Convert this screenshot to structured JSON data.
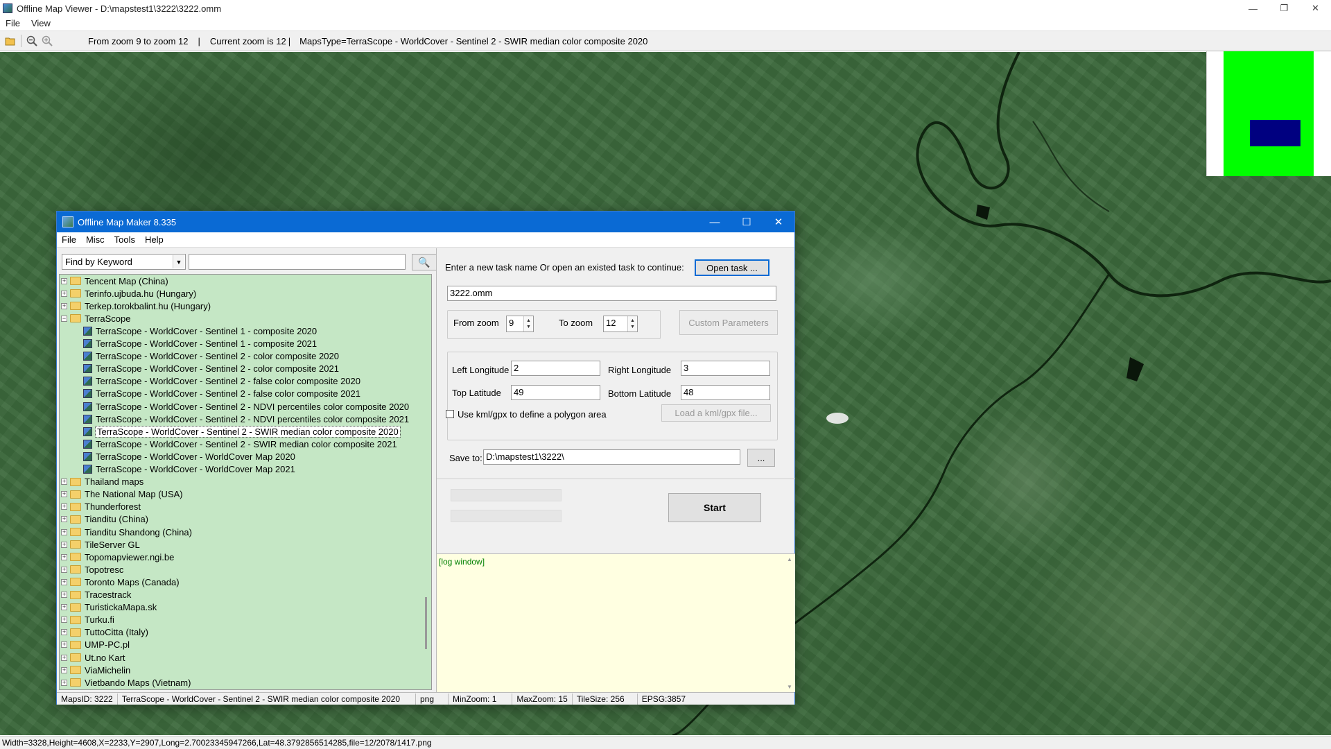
{
  "window": {
    "title": "Offline Map Viewer - D:\\mapstest1\\3222\\3222.omm",
    "minimize": "—",
    "maximize": "❐",
    "close": "✕"
  },
  "menu": [
    "File",
    "View"
  ],
  "toolbar": {
    "zoom_range": "From zoom 9 to zoom 12",
    "current_zoom": "Current zoom is 12",
    "maps_type": "MapsType=TerraScope - WorldCover - Sentinel 2 - SWIR median color composite 2020",
    "sep1": "|",
    "sep2": "|"
  },
  "statusbar": {
    "text": "Width=3328,Height=4608,X=2233,Y=2907,Long=2.70023345947266,Lat=48.3792856514285,file=12/2078/1417.png"
  },
  "minimap": {
    "bg_color": "#00ff00",
    "view_color": "#000080"
  },
  "dialog": {
    "title": "Offline Map Maker 8.335",
    "minimize": "—",
    "maximize": "☐",
    "close": "✕",
    "menu": [
      "File",
      "Misc",
      "Tools",
      "Help"
    ],
    "search": {
      "mode": "Find by Keyword",
      "keyword": "",
      "dropdown_glyph": "▼",
      "search_glyph": "🔍"
    },
    "tree": [
      {
        "label": "Tencent Map (China)",
        "type": "folder",
        "expanded": false
      },
      {
        "label": "Terinfo.ujbuda.hu (Hungary)",
        "type": "folder",
        "expanded": false
      },
      {
        "label": "Terkep.torokbalint.hu (Hungary)",
        "type": "folder",
        "expanded": false
      },
      {
        "label": "TerraScope",
        "type": "folder",
        "expanded": true
      },
      {
        "label": "TerraScope - WorldCover - Sentinel 1 - composite 2020",
        "type": "map"
      },
      {
        "label": "TerraScope - WorldCover - Sentinel 1 - composite 2021",
        "type": "map"
      },
      {
        "label": "TerraScope - WorldCover - Sentinel 2 - color composite 2020",
        "type": "map"
      },
      {
        "label": "TerraScope - WorldCover - Sentinel 2 - color composite 2021",
        "type": "map"
      },
      {
        "label": "TerraScope - WorldCover - Sentinel 2 - false color composite 2020",
        "type": "map"
      },
      {
        "label": "TerraScope - WorldCover - Sentinel 2 - false color composite 2021",
        "type": "map"
      },
      {
        "label": "TerraScope - WorldCover - Sentinel 2 - NDVI percentiles color composite 2020",
        "type": "map"
      },
      {
        "label": "TerraScope - WorldCover - Sentinel 2 - NDVI percentiles color composite 2021",
        "type": "map"
      },
      {
        "label": "TerraScope - WorldCover - Sentinel 2 - SWIR median color composite 2020",
        "type": "map",
        "selected": true
      },
      {
        "label": "TerraScope - WorldCover - Sentinel 2 - SWIR median color composite 2021",
        "type": "map"
      },
      {
        "label": "TerraScope - WorldCover - WorldCover Map 2020",
        "type": "map"
      },
      {
        "label": "TerraScope - WorldCover - WorldCover Map 2021",
        "type": "map"
      },
      {
        "label": "Thailand maps",
        "type": "folder",
        "expanded": false
      },
      {
        "label": "The National Map (USA)",
        "type": "folder",
        "expanded": false
      },
      {
        "label": "Thunderforest",
        "type": "folder",
        "expanded": false
      },
      {
        "label": "Tianditu (China)",
        "type": "folder",
        "expanded": false
      },
      {
        "label": "Tianditu Shandong (China)",
        "type": "folder",
        "expanded": false
      },
      {
        "label": "TileServer GL",
        "type": "folder",
        "expanded": false
      },
      {
        "label": "Topomapviewer.ngi.be",
        "type": "folder",
        "expanded": false
      },
      {
        "label": "Topotresc",
        "type": "folder",
        "expanded": false
      },
      {
        "label": "Toronto Maps (Canada)",
        "type": "folder",
        "expanded": false
      },
      {
        "label": "Tracestrack",
        "type": "folder",
        "expanded": false
      },
      {
        "label": "TuristickaMapa.sk",
        "type": "folder",
        "expanded": false
      },
      {
        "label": "Turku.fi",
        "type": "folder",
        "expanded": false
      },
      {
        "label": "TuttoCitta (Italy)",
        "type": "folder",
        "expanded": false
      },
      {
        "label": "UMP-PC.pl",
        "type": "folder",
        "expanded": false
      },
      {
        "label": "Ut.no Kart",
        "type": "folder",
        "expanded": false
      },
      {
        "label": "ViaMichelin",
        "type": "folder",
        "expanded": false
      },
      {
        "label": "Vietbando Maps (Vietnam)",
        "type": "folder",
        "expanded": false
      }
    ],
    "task": {
      "prompt": "Enter a new task name Or open an existed task to continue:",
      "open_button": "Open task ...",
      "name": "3222.omm"
    },
    "zoom": {
      "from_label": "From zoom",
      "from_value": "9",
      "to_label": "To zoom",
      "to_value": "12",
      "custom_button": "Custom Parameters",
      "spin_up": "▲",
      "spin_down": "▼"
    },
    "bounds": {
      "left_lon_label": "Left Longitude",
      "left_lon": "2",
      "right_lon_label": "Right Longitude",
      "right_lon": "3",
      "top_lat_label": "Top Latitude",
      "top_lat": "49",
      "bottom_lat_label": "Bottom Latitude",
      "bottom_lat": "48",
      "kml_label": "Use kml/gpx to define a polygon area",
      "kml_checked": false,
      "kml_button": "Load a kml/gpx file..."
    },
    "save": {
      "label": "Save to:",
      "path": "D:\\mapstest1\\3222\\",
      "browse": "..."
    },
    "start_button": "Start",
    "log": {
      "text": "[log window]",
      "up": "▲",
      "down": "▼"
    },
    "status": {
      "maps_id": "MapsID: 3222",
      "map_name": "TerraScope - WorldCover - Sentinel 2 - SWIR median color composite 2020",
      "format": "png",
      "min_zoom": "MinZoom: 1",
      "max_zoom": "MaxZoom: 15",
      "tile_size": "TileSize: 256",
      "epsg": "EPSG:3857"
    }
  }
}
